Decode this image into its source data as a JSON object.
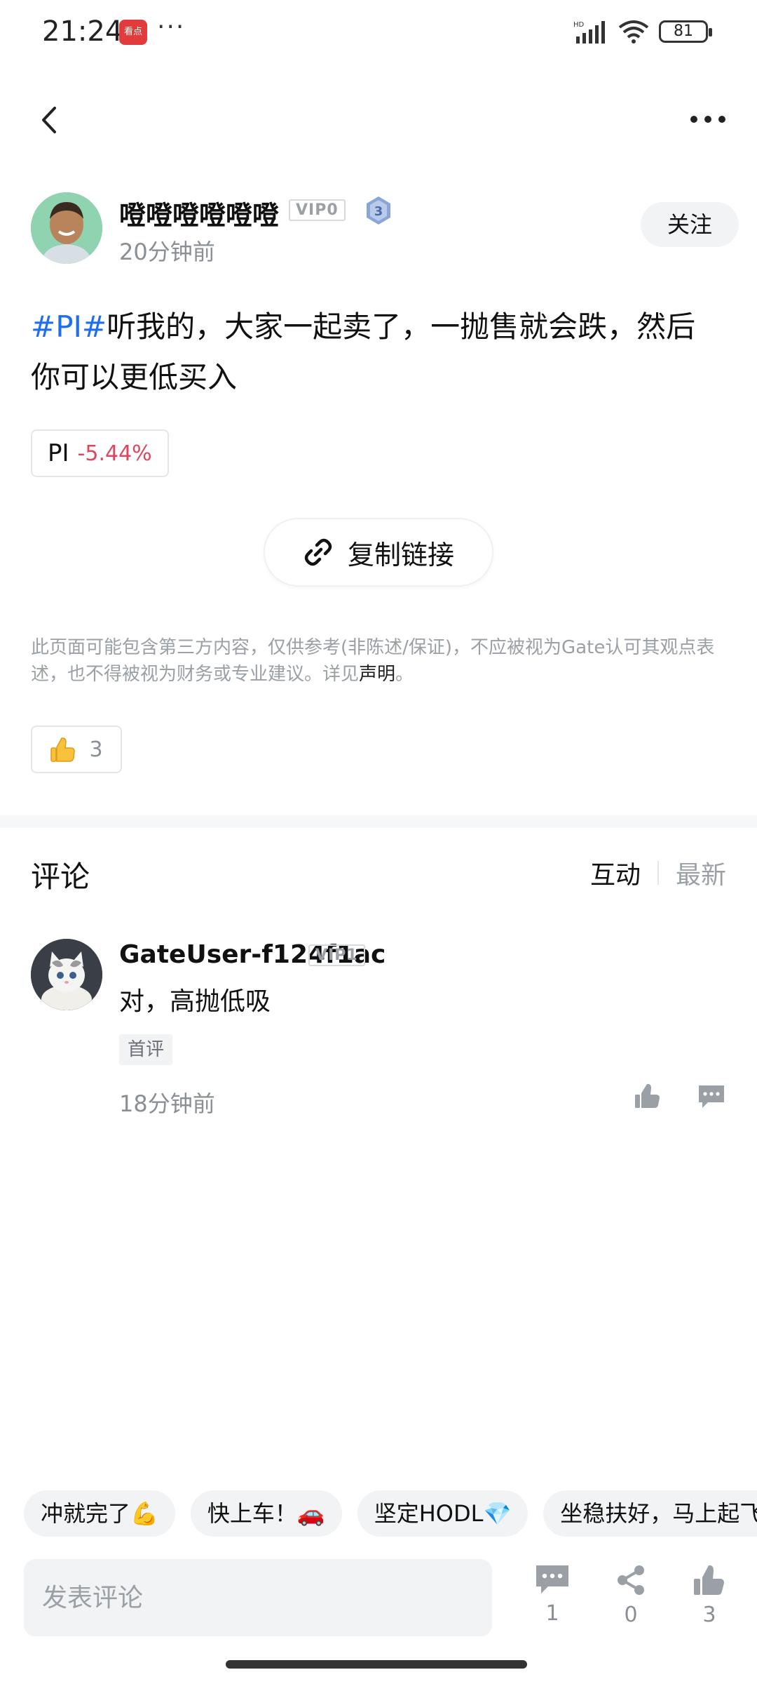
{
  "status_bar": {
    "time": "21:24",
    "app_icon_text": "看点",
    "more": "···",
    "network": "HD",
    "battery": "81"
  },
  "nav": {
    "back_icon": "chevron-left-icon",
    "more_icon": "more-horizontal-icon"
  },
  "post": {
    "author": {
      "name": "噔噔噔噔噔噔",
      "vip": "VIP0",
      "level": "3",
      "time": "20分钟前",
      "follow_label": "关注"
    },
    "hashtag": "#PI#",
    "text": "听我的，大家一起卖了，一抛售就会跌，然后你可以更低买入",
    "ticker": {
      "name": "PI",
      "change": "-5.44%",
      "change_color": "#e0455f"
    },
    "copy_link_label": "复制链接",
    "disclaimer": "此页面可能包含第三方内容，仅供参考(非陈述/保证)，不应被视为Gate认可其观点表述，也不得被视为财务或专业建议。详见",
    "disclaimer_link": "声明",
    "disclaimer_end": "。",
    "likes": "3"
  },
  "comments": {
    "title": "评论",
    "tabs": [
      "互动",
      "最新"
    ],
    "active_tab": "互动",
    "items": [
      {
        "user": "GateUser-f124f1ac",
        "vip": "VIP1",
        "text": "对，高抛低吸",
        "tag": "首评",
        "time": "18分钟前"
      }
    ]
  },
  "quick_replies": [
    "冲就完了💪",
    "快上车！🚗",
    "坚定HODL💎",
    "坐稳扶好，马上起飞"
  ],
  "bottom_bar": {
    "input_placeholder": "发表评论",
    "comment_count": "1",
    "share_count": "0",
    "like_count": "3"
  },
  "colors": {
    "hashtag": "#1f6feb",
    "negative": "#e0455f",
    "muted": "#9aa0a6"
  }
}
